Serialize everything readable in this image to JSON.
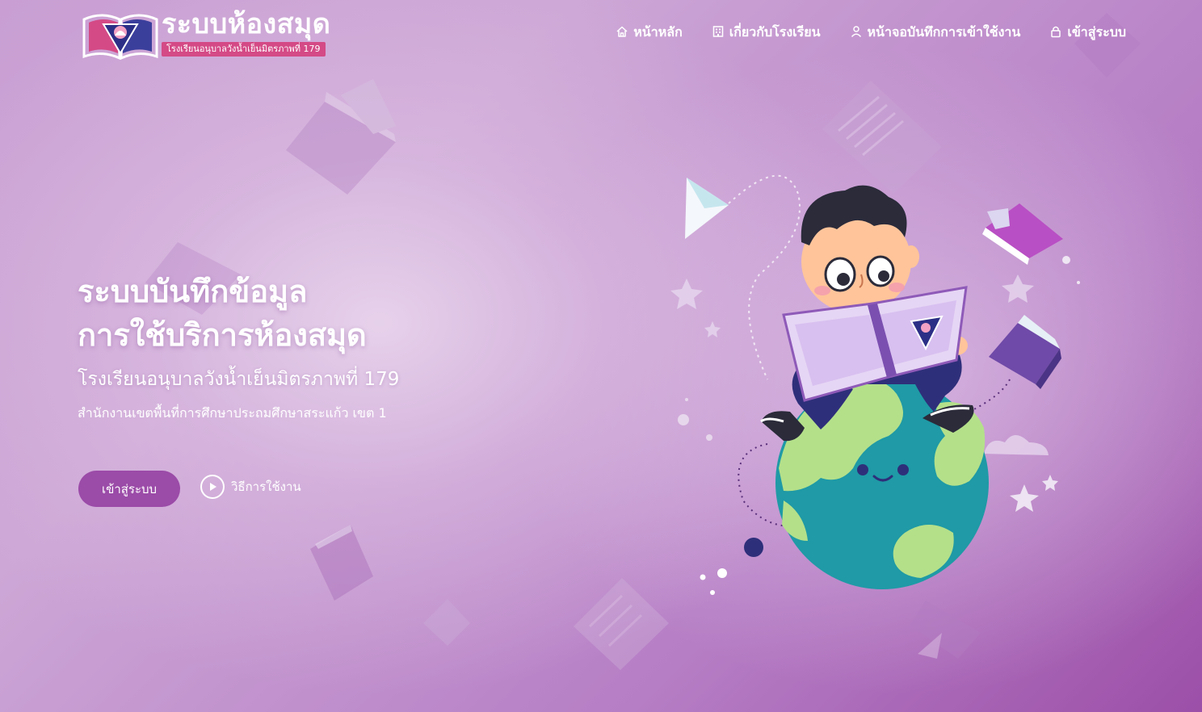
{
  "header": {
    "logo_title": "ระบบห้องสมุด",
    "logo_subtitle": "โรงเรียนอนุบาลวังน้ำเย็นมิตรภาพที่ 179"
  },
  "nav": {
    "items": [
      {
        "label": "หน้าหลัก",
        "icon": "home-icon"
      },
      {
        "label": "เกี่ยวกับโรงเรียน",
        "icon": "building-icon"
      },
      {
        "label": "หน้าจอบันทึกการเข้าใช้งาน",
        "icon": "user-icon"
      },
      {
        "label": "เข้าสู่ระบบ",
        "icon": "lock-icon"
      }
    ]
  },
  "hero": {
    "title_line1": "ระบบบันทึกข้อมูล",
    "title_line2": "การใช้บริการห้องสมุด",
    "school": "โรงเรียนอนุบาลวังน้ำเย็นมิตรภาพที่ 179",
    "office": "สำนักงานเขตพื้นที่การศึกษาประถมศึกษาสระแก้ว เขต 1",
    "login_label": "เข้าสู่ระบบ",
    "howto_label": "วิธีการใช้งาน"
  },
  "colors": {
    "accent": "#9b4ba8",
    "logo_badge": "#d44a86",
    "text": "#ffffff"
  }
}
